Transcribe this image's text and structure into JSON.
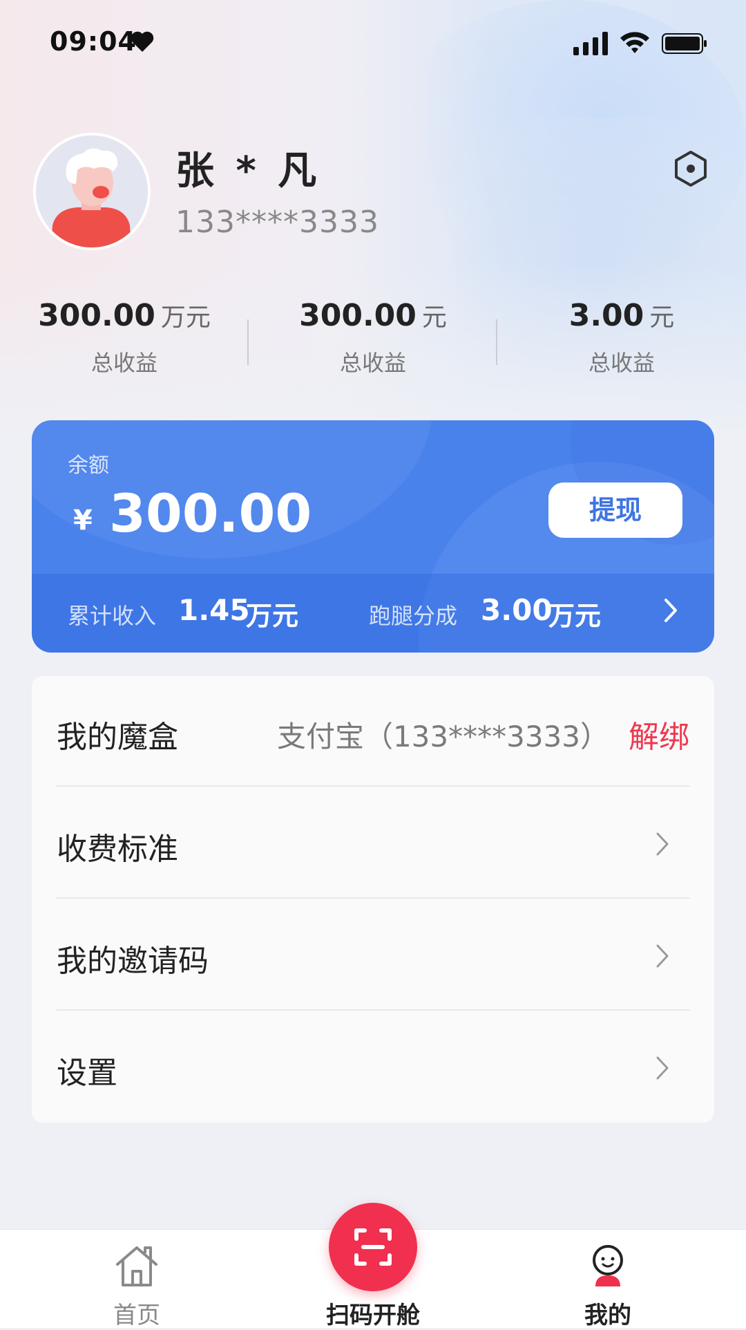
{
  "status_bar": {
    "time": "09:04"
  },
  "profile": {
    "name": "张 * 凡",
    "phone": "133****3333"
  },
  "stats": [
    {
      "value": "300.00",
      "unit": "万元",
      "label": "总收益"
    },
    {
      "value": "300.00",
      "unit": "元",
      "label": "总收益"
    },
    {
      "value": "3.00",
      "unit": "元",
      "label": "总收益"
    }
  ],
  "balance_card": {
    "label": "余额",
    "currency_symbol": "¥",
    "amount": "300.00",
    "withdraw_label": "提现",
    "cumulative_label": "累计收入",
    "cumulative_value": "1.45",
    "cumulative_unit": "万元",
    "running_label": "跑腿分成",
    "running_value": "3.00",
    "running_unit": "万元"
  },
  "menu": {
    "items": [
      {
        "label": "我的魔盒",
        "payment": "支付宝（133****3333）",
        "action": "解绑"
      },
      {
        "label": "收费标准"
      },
      {
        "label": "我的邀请码"
      },
      {
        "label": "设置"
      }
    ]
  },
  "tabbar": {
    "tabs": [
      {
        "label": "首页",
        "icon": "home-icon"
      },
      {
        "label": "扫码开舱",
        "icon": "scan-icon"
      },
      {
        "label": "我的",
        "icon": "profile-icon"
      }
    ]
  },
  "colors": {
    "accent_blue": "#4a82ec",
    "accent_red": "#f0304e",
    "unbind_red": "#f0384e"
  }
}
